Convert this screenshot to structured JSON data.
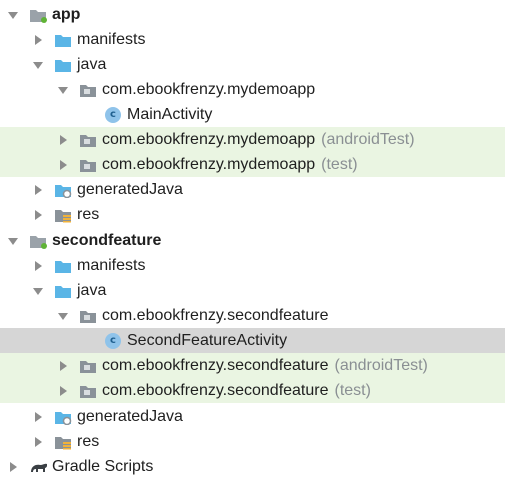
{
  "tree": {
    "items": [
      {
        "label": "app",
        "suffix": "",
        "icon": "module-icon"
      },
      {
        "label": "manifests",
        "suffix": "",
        "icon": "folder-icon"
      },
      {
        "label": "java",
        "suffix": "",
        "icon": "folder-icon"
      },
      {
        "label": "com.ebookfrenzy.mydemoapp",
        "suffix": "",
        "icon": "package-icon"
      },
      {
        "label": "MainActivity",
        "suffix": "",
        "icon": "class-icon"
      },
      {
        "label": "com.ebookfrenzy.mydemoapp",
        "suffix": "(androidTest)",
        "icon": "package-icon"
      },
      {
        "label": "com.ebookfrenzy.mydemoapp",
        "suffix": "(test)",
        "icon": "package-icon"
      },
      {
        "label": "generatedJava",
        "suffix": "",
        "icon": "generated-folder-icon"
      },
      {
        "label": "res",
        "suffix": "",
        "icon": "res-folder-icon"
      },
      {
        "label": "secondfeature",
        "suffix": "",
        "icon": "module-icon"
      },
      {
        "label": "manifests",
        "suffix": "",
        "icon": "folder-icon"
      },
      {
        "label": "java",
        "suffix": "",
        "icon": "folder-icon"
      },
      {
        "label": "com.ebookfrenzy.secondfeature",
        "suffix": "",
        "icon": "package-icon"
      },
      {
        "label": "SecondFeatureActivity",
        "suffix": "",
        "icon": "class-icon"
      },
      {
        "label": "com.ebookfrenzy.secondfeature",
        "suffix": "(androidTest)",
        "icon": "package-icon"
      },
      {
        "label": "com.ebookfrenzy.secondfeature",
        "suffix": "(test)",
        "icon": "package-icon"
      },
      {
        "label": "generatedJava",
        "suffix": "",
        "icon": "generated-folder-icon"
      },
      {
        "label": "res",
        "suffix": "",
        "icon": "res-folder-icon"
      },
      {
        "label": "Gradle Scripts",
        "suffix": "",
        "icon": "gradle-icon"
      }
    ],
    "class_badge": "c",
    "colors": {
      "folder": "#5ab5e6",
      "package": "#8a9299",
      "green_row": "#eaf5e2",
      "selected_row": "#d6d6d6",
      "suffix_text": "#8a8f93"
    }
  }
}
